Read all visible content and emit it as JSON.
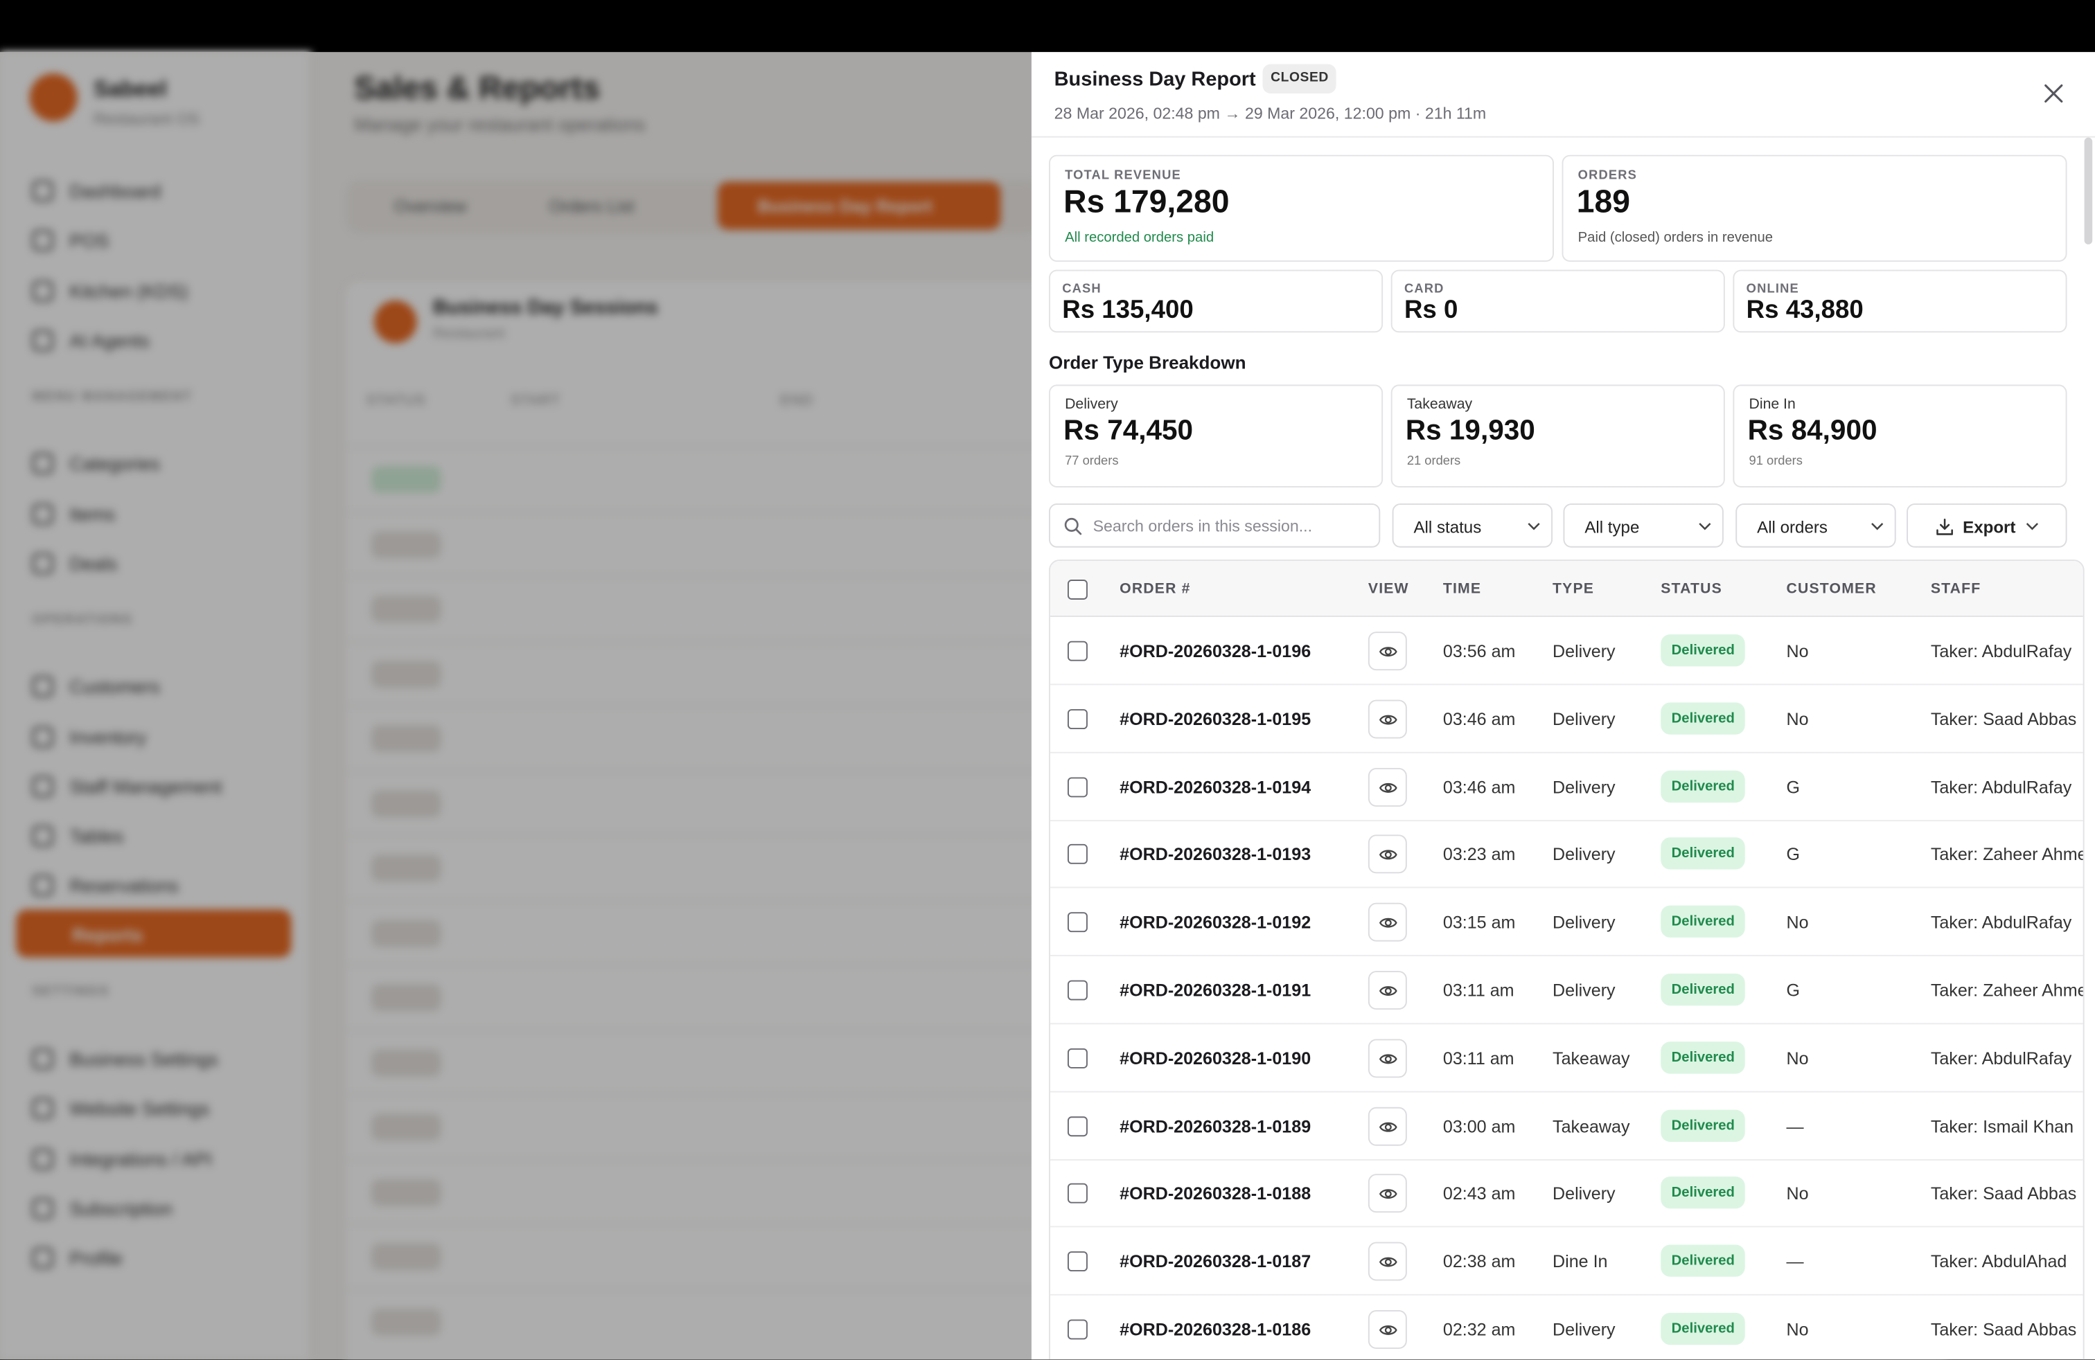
{
  "background": {
    "brand": "Sabeel",
    "brand_sub": "Restaurant OS",
    "sidebar_items": [
      {
        "label": "Dashboard"
      },
      {
        "label": "POS"
      },
      {
        "label": "Kitchen (KDS)"
      },
      {
        "label": "AI Agents"
      },
      {
        "label": "Categories"
      },
      {
        "label": "Items"
      },
      {
        "label": "Deals"
      },
      {
        "label": "Customers"
      },
      {
        "label": "Inventory"
      },
      {
        "label": "Staff Management"
      },
      {
        "label": "Tables"
      },
      {
        "label": "Reservations"
      },
      {
        "label": "Business Settings"
      },
      {
        "label": "Website Settings"
      },
      {
        "label": "Integrations / API"
      },
      {
        "label": "Subscription"
      },
      {
        "label": "Profile"
      }
    ],
    "sidebar_sections": [
      "MENU MANAGEMENT",
      "OPERATIONS",
      "SETTINGS"
    ],
    "sidebar_active": "Reports",
    "page_title": "Sales & Reports",
    "page_subtitle": "Manage your restaurant operations",
    "tabs": [
      "Overview",
      "Orders List",
      "Business Day Report"
    ],
    "card_title": "Business Day Sessions",
    "card_sub": "Restaurant",
    "columns": [
      "STATUS",
      "START",
      "END"
    ]
  },
  "panel": {
    "title": "Business Day Report",
    "badge": "CLOSED",
    "range": "28 Mar 2026, 02:48 pm → 29 Mar 2026, 12:00 pm · 21h 11m",
    "summary": {
      "total_revenue_label": "TOTAL REVENUE",
      "total_revenue_value": "Rs 179,280",
      "total_revenue_note": "All recorded orders paid",
      "orders_label": "ORDERS",
      "orders_value": "189",
      "orders_note": "Paid (closed) orders in revenue"
    },
    "payments": [
      {
        "label": "CASH",
        "value": "Rs 135,400"
      },
      {
        "label": "CARD",
        "value": "Rs 0"
      },
      {
        "label": "ONLINE",
        "value": "Rs 43,880"
      }
    ],
    "breakdown_title": "Order Type Breakdown",
    "breakdown": [
      {
        "name": "Delivery",
        "value": "Rs 74,450",
        "count": "77 orders"
      },
      {
        "name": "Takeaway",
        "value": "Rs 19,930",
        "count": "21 orders"
      },
      {
        "name": "Dine In",
        "value": "Rs 84,900",
        "count": "91 orders"
      }
    ],
    "filters": {
      "search_placeholder": "Search orders in this session...",
      "status": "All status",
      "type": "All type",
      "orders": "All orders",
      "export": "Export"
    },
    "table": {
      "headers": {
        "order": "ORDER #",
        "view": "VIEW",
        "time": "TIME",
        "type": "TYPE",
        "status": "STATUS",
        "customer": "CUSTOMER",
        "staff": "STAFF"
      },
      "rows": [
        {
          "order": "#ORD-20260328-1-0196",
          "time": "03:56 am",
          "type": "Delivery",
          "status": "Delivered",
          "customer": "No",
          "staff": "Taker: AbdulRafay"
        },
        {
          "order": "#ORD-20260328-1-0195",
          "time": "03:46 am",
          "type": "Delivery",
          "status": "Delivered",
          "customer": "No",
          "staff": "Taker: Saad Abbas"
        },
        {
          "order": "#ORD-20260328-1-0194",
          "time": "03:46 am",
          "type": "Delivery",
          "status": "Delivered",
          "customer": "G",
          "staff": "Taker: AbdulRafay"
        },
        {
          "order": "#ORD-20260328-1-0193",
          "time": "03:23 am",
          "type": "Delivery",
          "status": "Delivered",
          "customer": "G",
          "staff": "Taker: Zaheer Ahmed"
        },
        {
          "order": "#ORD-20260328-1-0192",
          "time": "03:15 am",
          "type": "Delivery",
          "status": "Delivered",
          "customer": "No",
          "staff": "Taker: AbdulRafay"
        },
        {
          "order": "#ORD-20260328-1-0191",
          "time": "03:11 am",
          "type": "Delivery",
          "status": "Delivered",
          "customer": "G",
          "staff": "Taker: Zaheer Ahmed"
        },
        {
          "order": "#ORD-20260328-1-0190",
          "time": "03:11 am",
          "type": "Takeaway",
          "status": "Delivered",
          "customer": "No",
          "staff": "Taker: AbdulRafay"
        },
        {
          "order": "#ORD-20260328-1-0189",
          "time": "03:00 am",
          "type": "Takeaway",
          "status": "Delivered",
          "customer": "—",
          "staff": "Taker: Ismail Khan"
        },
        {
          "order": "#ORD-20260328-1-0188",
          "time": "02:43 am",
          "type": "Delivery",
          "status": "Delivered",
          "customer": "No",
          "staff": "Taker: Saad Abbas"
        },
        {
          "order": "#ORD-20260328-1-0187",
          "time": "02:38 am",
          "type": "Dine In",
          "status": "Delivered",
          "customer": "—",
          "staff": "Taker: AbdulAhad"
        },
        {
          "order": "#ORD-20260328-1-0186",
          "time": "02:32 am",
          "type": "Delivery",
          "status": "Delivered",
          "customer": "No",
          "staff": "Taker: Saad Abbas"
        }
      ]
    }
  },
  "colors": {
    "accent": "#e86a24",
    "delivered_bg": "#dcf5e3",
    "delivered_text": "#1f8a4c"
  }
}
